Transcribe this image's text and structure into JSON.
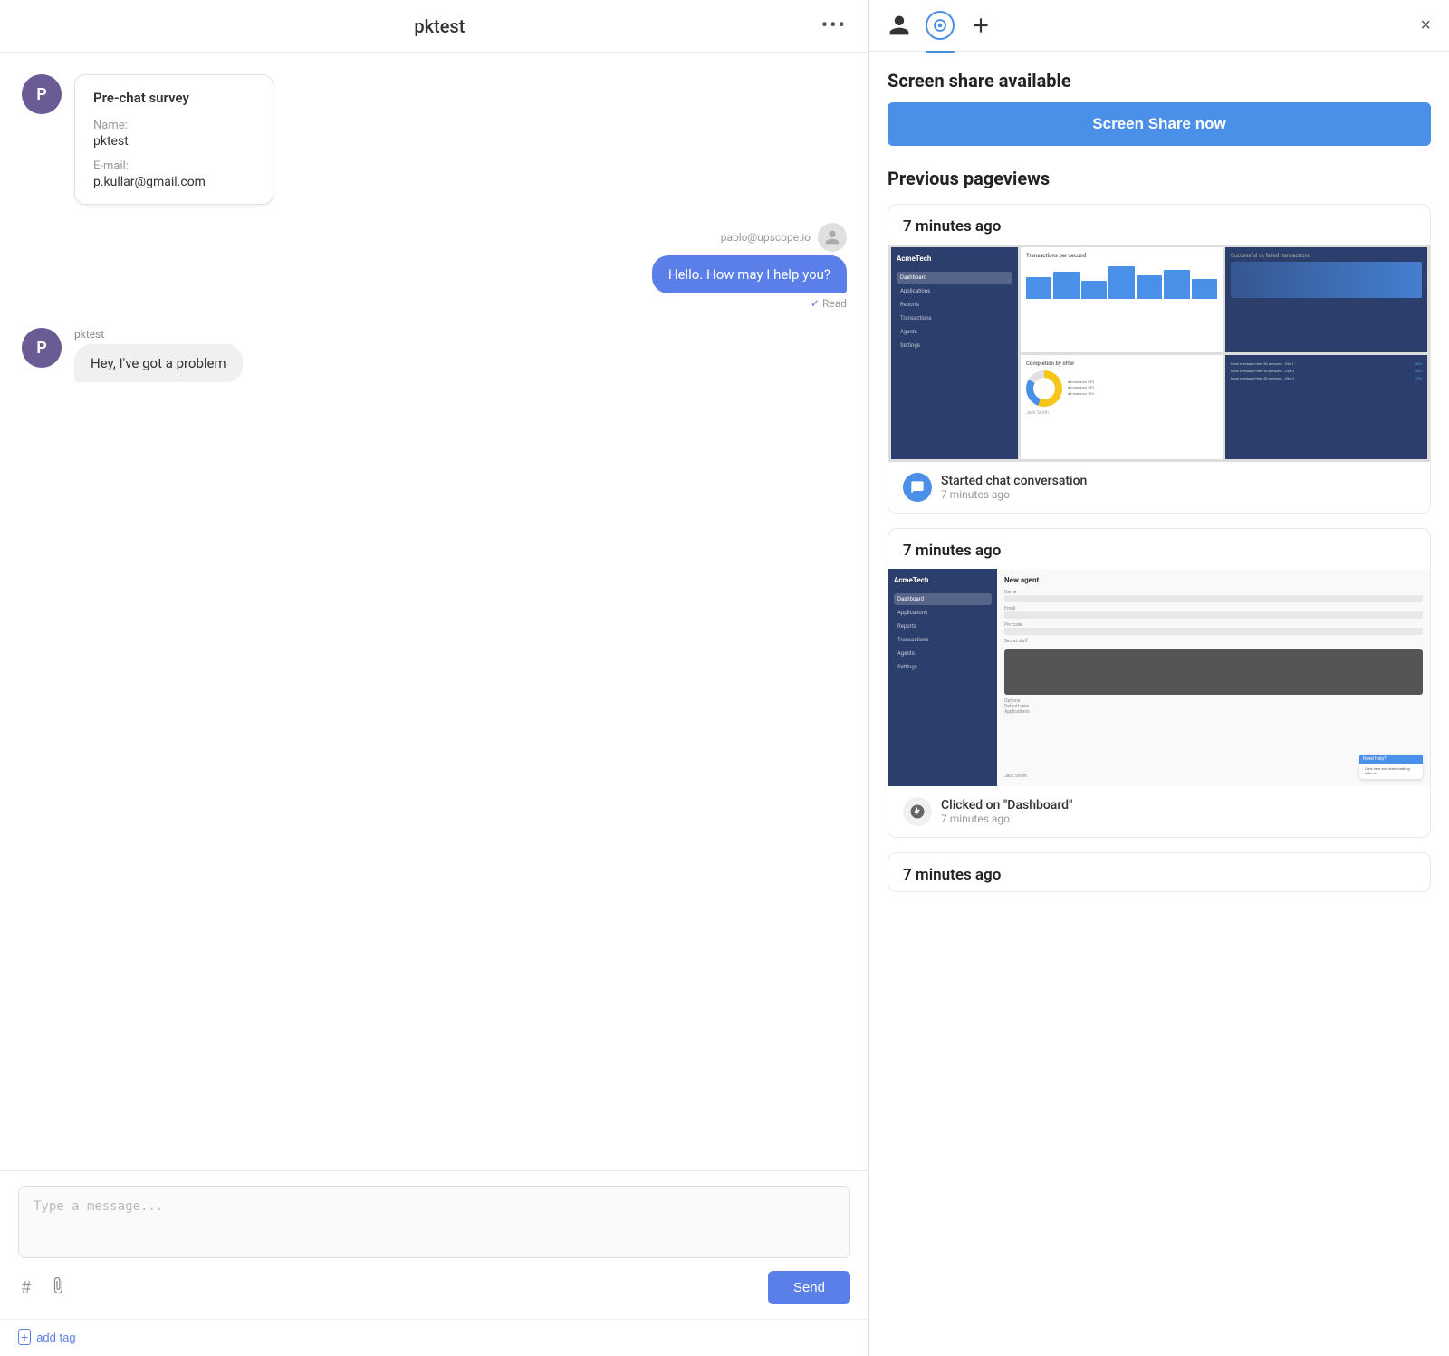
{
  "leftPanel": {
    "header": {
      "title": "pktest",
      "menuIcon": "•••"
    },
    "prechat": {
      "avatar": "P",
      "title": "Pre-chat survey",
      "fields": [
        {
          "label": "Name:",
          "value": "pktest"
        },
        {
          "label": "E-mail:",
          "value": "p.kullar@gmail.com"
        }
      ]
    },
    "messages": [
      {
        "type": "outgoing",
        "sender": "pablo@upscope.io",
        "text": "Hello. How may I help you?",
        "readStatus": "Read"
      },
      {
        "type": "incoming",
        "sender": "pktest",
        "text": "Hey, I've got a problem"
      }
    ],
    "input": {
      "placeholder": "Type a message...",
      "sendLabel": "Send",
      "hashIcon": "#",
      "attachIcon": "📎"
    },
    "addTag": {
      "label": "add tag"
    }
  },
  "rightPanel": {
    "header": {
      "closeLabel": "×"
    },
    "screenShare": {
      "title": "Screen share available",
      "buttonLabel": "Screen Share now"
    },
    "pageviews": {
      "title": "Previous pageviews",
      "cards": [
        {
          "time": "7 minutes ago",
          "event": "Started chat conversation",
          "eventTime": "7 minutes ago",
          "eventType": "chat"
        },
        {
          "time": "7 minutes ago",
          "event": "Clicked on \"Dashboard\"",
          "eventTime": "7 minutes ago",
          "eventType": "click"
        },
        {
          "time": "7 minutes ago"
        }
      ]
    }
  }
}
